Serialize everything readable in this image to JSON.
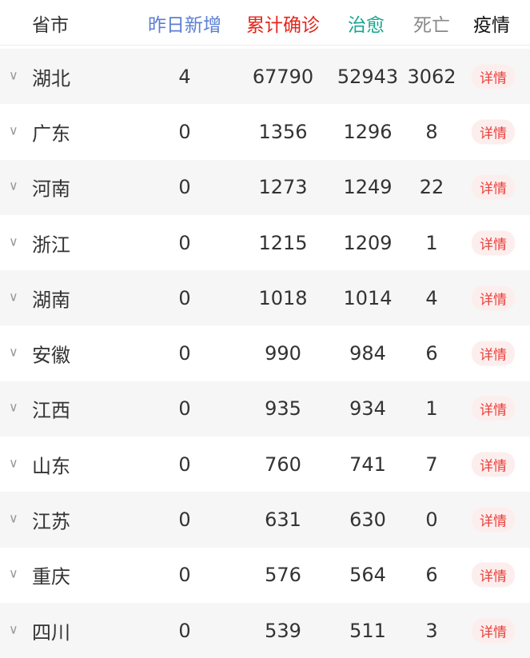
{
  "header": {
    "province": "省市",
    "new_yesterday": "昨日新增",
    "confirmed": "累计确诊",
    "cured": "治愈",
    "deaths": "死亡",
    "epidemic": "疫情"
  },
  "colors": {
    "new_yesterday": "#5b7fd1",
    "confirmed": "#e3261b",
    "cured": "#1aa590",
    "deaths": "#888888",
    "detail": "#e8403a"
  },
  "detail_label": "详情",
  "rows": [
    {
      "province": "湖北",
      "new": "4",
      "confirmed": "67790",
      "cured": "52943",
      "deaths": "3062"
    },
    {
      "province": "广东",
      "new": "0",
      "confirmed": "1356",
      "cured": "1296",
      "deaths": "8"
    },
    {
      "province": "河南",
      "new": "0",
      "confirmed": "1273",
      "cured": "1249",
      "deaths": "22"
    },
    {
      "province": "浙江",
      "new": "0",
      "confirmed": "1215",
      "cured": "1209",
      "deaths": "1"
    },
    {
      "province": "湖南",
      "new": "0",
      "confirmed": "1018",
      "cured": "1014",
      "deaths": "4"
    },
    {
      "province": "安徽",
      "new": "0",
      "confirmed": "990",
      "cured": "984",
      "deaths": "6"
    },
    {
      "province": "江西",
      "new": "0",
      "confirmed": "935",
      "cured": "934",
      "deaths": "1"
    },
    {
      "province": "山东",
      "new": "0",
      "confirmed": "760",
      "cured": "741",
      "deaths": "7"
    },
    {
      "province": "江苏",
      "new": "0",
      "confirmed": "631",
      "cured": "630",
      "deaths": "0"
    },
    {
      "province": "重庆",
      "new": "0",
      "confirmed": "576",
      "cured": "564",
      "deaths": "6"
    },
    {
      "province": "四川",
      "new": "0",
      "confirmed": "539",
      "cured": "511",
      "deaths": "3"
    }
  ]
}
